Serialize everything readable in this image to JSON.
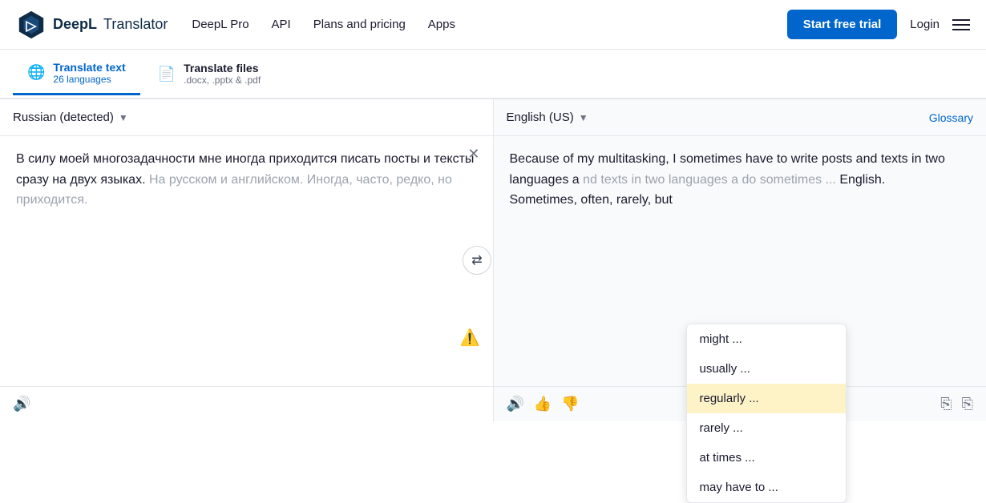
{
  "header": {
    "logo_brand": "DeepL",
    "logo_product": "Translator",
    "nav_items": [
      {
        "label": "DeepL Pro",
        "id": "deepl-pro"
      },
      {
        "label": "API",
        "id": "api"
      },
      {
        "label": "Plans and pricing",
        "id": "plans"
      },
      {
        "label": "Apps",
        "id": "apps"
      }
    ],
    "btn_trial": "Start free trial",
    "btn_login": "Login"
  },
  "tabs": [
    {
      "id": "translate-text",
      "icon": "🌐",
      "label": "Translate text",
      "sublabel": "26 languages",
      "active": true
    },
    {
      "id": "translate-files",
      "icon": "📄",
      "label": "Translate files",
      "sublabel": ".docx, .pptx & .pdf",
      "active": false
    }
  ],
  "left_panel": {
    "lang": "Russian (detected)",
    "source_text_main": "В силу моей многозадачности мне иногда приходится писать посты и тексты сразу на двух языках.",
    "source_text_alt": "На русском и английском. Иногда, часто, редко, но приходится."
  },
  "right_panel": {
    "lang": "English (US)",
    "glossary_label": "Glossary",
    "translated_text": "Because of my multitasking, I sometimes have to write posts and texts in two languages a",
    "translated_text2": "do sometimes ...",
    "translated_text3": "English.",
    "translated_text4": "Sometimes, often, rarely, but"
  },
  "dropdown": {
    "items": [
      {
        "label": "might ...",
        "highlighted": false
      },
      {
        "label": "usually ...",
        "highlighted": false
      },
      {
        "label": "regularly ...",
        "highlighted": true
      },
      {
        "label": "rarely ...",
        "highlighted": false
      },
      {
        "label": "at times ...",
        "highlighted": false
      },
      {
        "label": "may have to ...",
        "highlighted": false
      }
    ]
  }
}
